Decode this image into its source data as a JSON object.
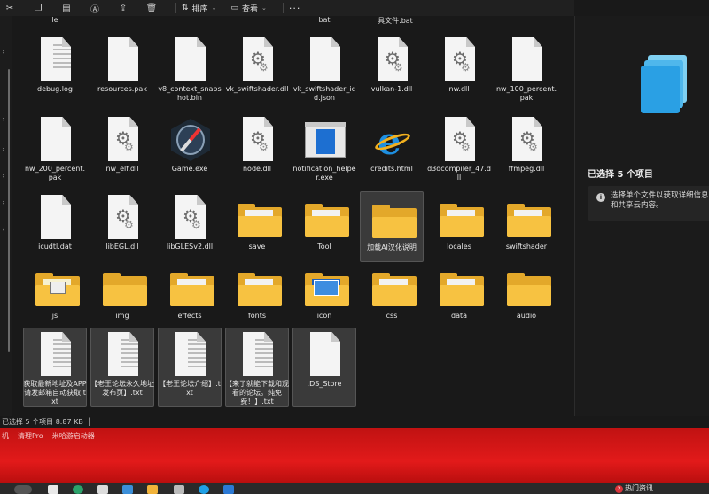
{
  "toolbar": {
    "sort_label": "排序",
    "view_label": "查看",
    "more_label": "···"
  },
  "top_row": [
    "le",
    "bat",
    "具文件.bat"
  ],
  "files": [
    {
      "name": "debug.log",
      "type": "doc-lines",
      "selected": false
    },
    {
      "name": "resources.pak",
      "type": "doc",
      "selected": false
    },
    {
      "name": "v8_context_snapshot.bin",
      "type": "doc",
      "selected": false
    },
    {
      "name": "vk_swiftshader.dll",
      "type": "dll",
      "selected": false
    },
    {
      "name": "vk_swiftshader_icd.json",
      "type": "doc",
      "selected": false
    },
    {
      "name": "vulkan-1.dll",
      "type": "dll",
      "selected": false
    },
    {
      "name": "nw.dll",
      "type": "dll",
      "selected": false
    },
    {
      "name": "nw_100_percent.pak",
      "type": "doc",
      "selected": false
    },
    {
      "name": "nw_200_percent.pak",
      "type": "doc",
      "selected": false
    },
    {
      "name": "nw_elf.dll",
      "type": "dll",
      "selected": false
    },
    {
      "name": "Game.exe",
      "type": "game",
      "selected": false
    },
    {
      "name": "node.dll",
      "type": "dll",
      "selected": false
    },
    {
      "name": "notification_helper.exe",
      "type": "exe",
      "selected": false
    },
    {
      "name": "credits.html",
      "type": "ie",
      "selected": false
    },
    {
      "name": "d3dcompiler_47.dll",
      "type": "dll",
      "selected": false
    },
    {
      "name": "ffmpeg.dll",
      "type": "dll",
      "selected": false
    },
    {
      "name": "icudtl.dat",
      "type": "doc",
      "selected": false
    },
    {
      "name": "libEGL.dll",
      "type": "dll",
      "selected": false
    },
    {
      "name": "libGLESv2.dll",
      "type": "dll",
      "selected": false
    },
    {
      "name": "save",
      "type": "folder",
      "selected": false
    },
    {
      "name": "Tool",
      "type": "folder",
      "selected": false
    },
    {
      "name": "加载AI汉化说明",
      "type": "folder-empty",
      "selected": true
    },
    {
      "name": "locales",
      "type": "folder",
      "selected": false
    },
    {
      "name": "swiftshader",
      "type": "folder",
      "selected": false
    },
    {
      "name": "js",
      "type": "folder-js",
      "selected": false
    },
    {
      "name": "img",
      "type": "folder-empty",
      "selected": false
    },
    {
      "name": "effects",
      "type": "folder",
      "selected": false
    },
    {
      "name": "fonts",
      "type": "folder",
      "selected": false
    },
    {
      "name": "icon",
      "type": "folder-icon",
      "selected": false
    },
    {
      "name": "css",
      "type": "folder",
      "selected": false
    },
    {
      "name": "data",
      "type": "folder",
      "selected": false
    },
    {
      "name": "audio",
      "type": "folder-empty",
      "selected": false
    },
    {
      "name": "获取最新地址及APP请发邮箱自动获取.txt",
      "type": "txt",
      "selected": true
    },
    {
      "name": "【老王论坛永久地址发布页】.txt",
      "type": "txt",
      "selected": true
    },
    {
      "name": "【老王论坛介绍】.txt",
      "type": "txt",
      "selected": true
    },
    {
      "name": "【来了就能下载和观看的论坛。纯免费！】.txt",
      "type": "txt",
      "selected": true
    },
    {
      "name": ".DS_Store",
      "type": "doc",
      "selected": true
    }
  ],
  "details_pane": {
    "title": "已选择 5 个项目",
    "info": "选择单个文件以获取详细信息和共享云内容。"
  },
  "status": {
    "text": "已选择 5 个项目  8.87 KB"
  },
  "desktop": {
    "labels": [
      "机",
      "清理Pro",
      "米哈游启动器"
    ]
  },
  "taskbar": {
    "news_badge": "2",
    "news_label": "热门资讯"
  },
  "colors": {
    "accent": "#e3a82a",
    "desktop_red": "#e21a1a",
    "selection": "#3a3a3a"
  }
}
